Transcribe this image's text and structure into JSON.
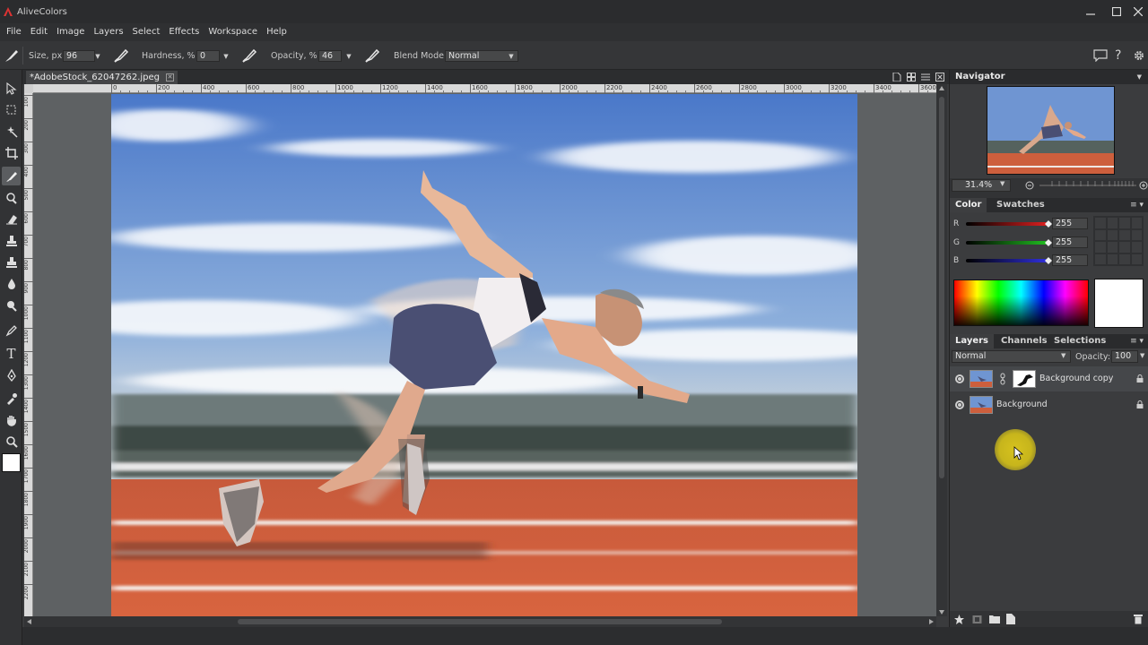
{
  "app": {
    "title": "AliveColors"
  },
  "menu": [
    "File",
    "Edit",
    "Image",
    "Layers",
    "Select",
    "Effects",
    "Workspace",
    "Help"
  ],
  "options": {
    "size_label": "Size, px",
    "size_value": "96",
    "hardness_label": "Hardness, %",
    "hardness_value": "0",
    "opacity_label": "Opacity, %",
    "opacity_value": "46",
    "blend_label": "Blend Mode:",
    "blend_value": "Normal"
  },
  "document": {
    "tab_title": "*AdobeStock_62047262.jpeg",
    "ruler_h": [
      "0",
      "200",
      "400",
      "600",
      "800",
      "1000",
      "1200",
      "1400",
      "1600",
      "1800",
      "2000",
      "2200",
      "2400",
      "2600",
      "2800",
      "3000",
      "3200",
      "3400",
      "3600"
    ],
    "ruler_v": [
      "100",
      "200",
      "300",
      "400",
      "500",
      "600",
      "700",
      "800",
      "900",
      "1000",
      "1100",
      "1200",
      "1300",
      "1400",
      "1500",
      "1600",
      "1700",
      "1800",
      "1900",
      "2000",
      "2100",
      "2200"
    ]
  },
  "navigator": {
    "title": "Navigator",
    "zoom": "31.4%"
  },
  "color_panel": {
    "tabs": [
      "Color",
      "Swatches"
    ],
    "channels": [
      {
        "label": "R",
        "value": "255",
        "color": "#e02020"
      },
      {
        "label": "G",
        "value": "255",
        "color": "#20c020"
      },
      {
        "label": "B",
        "value": "255",
        "color": "#3030e0"
      }
    ],
    "current_color": "#ffffff"
  },
  "layers_panel": {
    "tabs": [
      "Layers",
      "Channels",
      "Selections"
    ],
    "blend_mode": "Normal",
    "opacity_label": "Opacity:",
    "opacity_value": "100",
    "layers": [
      {
        "name": "Background copy",
        "has_mask": true
      },
      {
        "name": "Background",
        "has_mask": false
      }
    ]
  }
}
